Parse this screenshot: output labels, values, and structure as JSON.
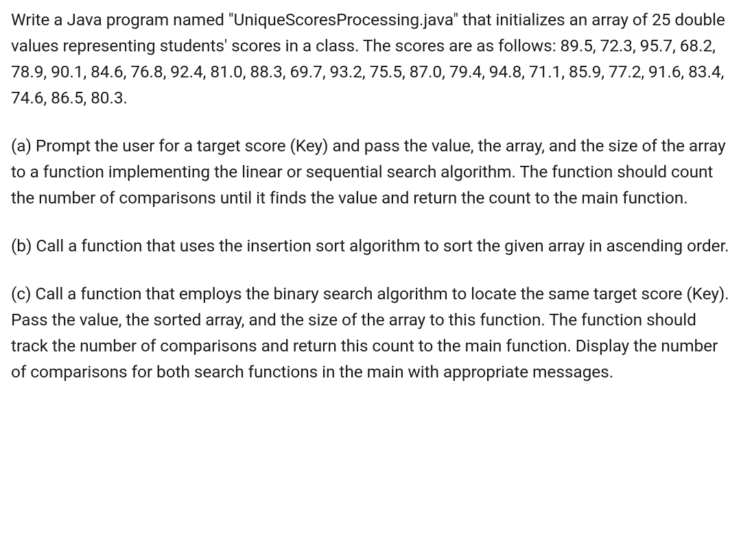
{
  "paragraphs": {
    "intro": "Write a Java program named \"UniqueScoresProcessing.java\" that initializes an array of 25 double values representing students' scores in a class. The scores are as follows: 89.5, 72.3, 95.7, 68.2, 78.9, 90.1, 84.6, 76.8, 92.4, 81.0, 88.3, 69.7, 93.2, 75.5, 87.0, 79.4, 94.8, 71.1, 85.9, 77.2, 91.6, 83.4, 74.6, 86.5, 80.3.",
    "partA": "(a) Prompt the user for a target score (Key) and pass the value, the array, and the size of the array to a function implementing the linear or sequential search algorithm. The function should count the number of comparisons until it finds the value and return the count to the main function.",
    "partB": "(b) Call a function that uses the insertion sort algorithm to sort the given array in ascending order.",
    "partC": "(c) Call a function that employs the binary search algorithm to locate the same target score (Key). Pass the value, the sorted array, and the size of the array to this function. The function should track the number of comparisons and return this count to the main function. Display the number of comparisons for both search functions in the main with appropriate messages."
  }
}
